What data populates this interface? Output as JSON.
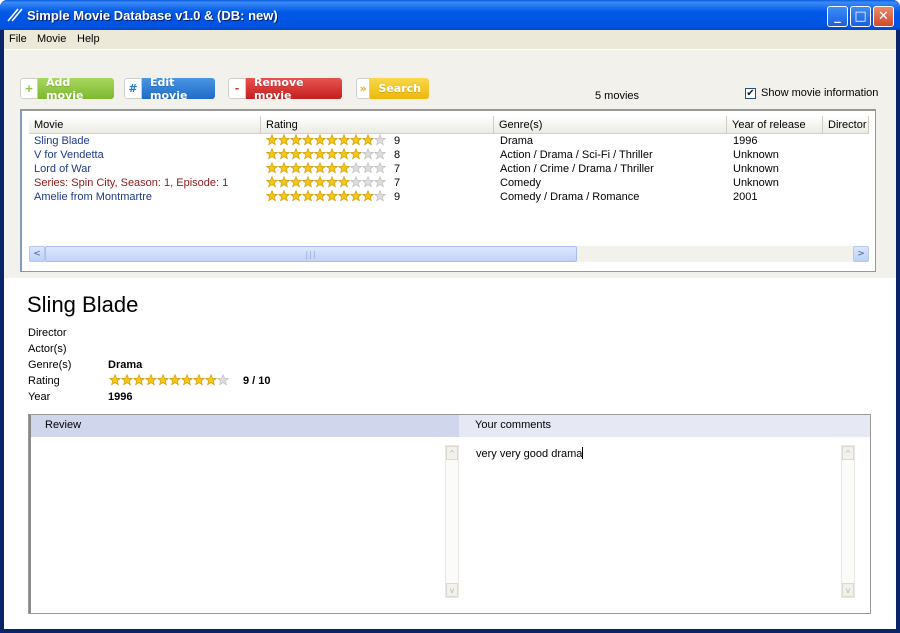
{
  "window": {
    "title": "Simple Movie Database v1.0 & (DB: new)",
    "minimize_glyph": "_",
    "maximize_glyph": "□",
    "close_glyph": "✕"
  },
  "menu": {
    "file": "File",
    "movie": "Movie",
    "help": "Help"
  },
  "toolbar": {
    "add": {
      "icon": "+",
      "label": "Add movie",
      "color": "#8CC63F"
    },
    "edit": {
      "icon": "#",
      "label": "Edit movie",
      "color": "#2C7BD3"
    },
    "remove": {
      "icon": "-",
      "label": "Remove movie",
      "color": "#D42E2E"
    },
    "search": {
      "icon": "»",
      "label": "Search",
      "color": "#F4C20D"
    },
    "count": "5 movies",
    "show_info_checked": "✔",
    "show_info_label": "Show movie information"
  },
  "list": {
    "columns": [
      "Movie",
      "Rating",
      "Genre(s)",
      "Year of release",
      "Director"
    ],
    "rows": [
      {
        "movie": "Sling Blade",
        "rating": 9,
        "rating_text": "9",
        "genres": "Drama",
        "year": "1996",
        "series": false
      },
      {
        "movie": "V for Vendetta",
        "rating": 8,
        "rating_text": "8",
        "genres": "Action / Drama / Sci-Fi / Thriller",
        "year": "Unknown",
        "series": false
      },
      {
        "movie": "Lord of War",
        "rating": 7,
        "rating_text": "7",
        "genres": "Action / Crime / Drama / Thriller",
        "year": "Unknown",
        "series": false
      },
      {
        "movie": "Series: Spin City, Season: 1, Episode: 1",
        "rating": 7,
        "rating_text": "7",
        "genres": "Comedy",
        "year": "Unknown",
        "series": true
      },
      {
        "movie": "Amelie from Montmartre",
        "rating": 9,
        "rating_text": "9",
        "genres": "Comedy / Drama / Romance",
        "year": "2001",
        "series": false
      }
    ],
    "max_rating": 10,
    "scroll_left": "<",
    "scroll_right": ">",
    "scroll_grip": "|||"
  },
  "details": {
    "title": "Sling Blade",
    "labels": {
      "director": "Director",
      "actors": "Actor(s)",
      "genres": "Genre(s)",
      "rating": "Rating",
      "year": "Year"
    },
    "genres": "Drama",
    "rating": 9,
    "rating_text": "9 / 10",
    "year": "1996",
    "review_header": "Review",
    "comments_header": "Your comments",
    "comments_text": "very very good drama",
    "scroll_up": "^",
    "scroll_down": "v"
  },
  "colors": {
    "star_filled": "#F5C518",
    "star_empty": "#DDDDDD",
    "review_header_bg": "#D0D6EC",
    "comments_header_bg": "#E6E9F4"
  }
}
